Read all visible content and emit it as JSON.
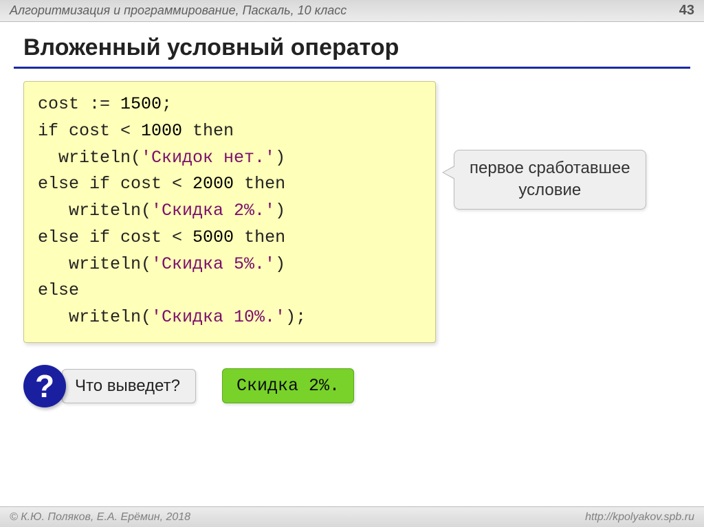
{
  "header": {
    "left": "Алгоритмизация и программирование, Паскаль, 10 класс",
    "page": "43"
  },
  "title": "Вложенный условный оператор",
  "code_lines": [
    {
      "t": "cost := ",
      "n": "1500",
      "s": ";"
    },
    {
      "t": "if cost < ",
      "n": "1000",
      "s": " then"
    },
    {
      "t": "  writeln(",
      "str": "'Скидок нет.'",
      "s": ")"
    },
    {
      "t": "else if cost < ",
      "n": "2000",
      "s": " then"
    },
    {
      "t": "   writeln(",
      "str": "'Скидка 2%.'",
      "s": ")"
    },
    {
      "t": "else if cost < ",
      "n": "5000",
      "s": " then"
    },
    {
      "t": "   writeln(",
      "str": "'Скидка 5%.'",
      "s": ")"
    },
    {
      "t": "else",
      "s": ""
    },
    {
      "t": "   writeln(",
      "str": "'Скидка 10%.'",
      "s": ");"
    }
  ],
  "annotation": "первое сработавшее\nусловие",
  "question_mark": "?",
  "question": " Что выведет?",
  "answer": "Скидка 2%.",
  "footer": {
    "left": "© К.Ю. Поляков, Е.А. Ерёмин, 2018",
    "right": "http://kpolyakov.spb.ru"
  }
}
